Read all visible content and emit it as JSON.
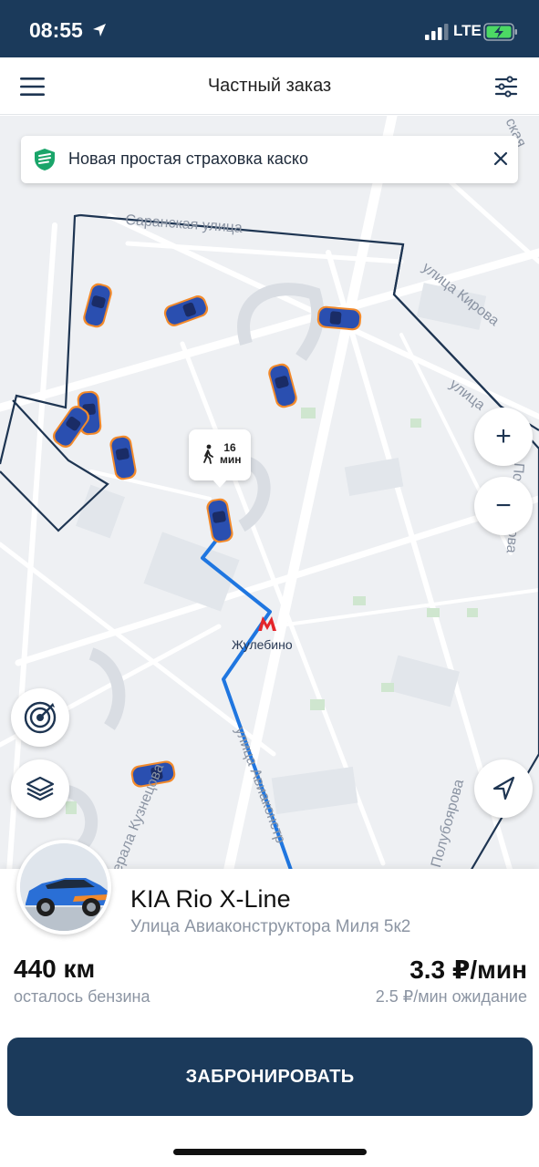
{
  "status_bar": {
    "time": "08:55",
    "network": "LTE",
    "icons": [
      "location-arrow-icon",
      "signal-icon",
      "battery-charging-icon"
    ]
  },
  "header": {
    "title": "Частный заказ",
    "menu_icon": "hamburger-menu-icon",
    "filter_icon": "filter-sliders-icon"
  },
  "promo": {
    "text": "Новая простая страховка каско",
    "icon": "shield-icon",
    "close_icon": "close-icon"
  },
  "map": {
    "walk_time": "16\nмин",
    "walk_icon": "walking-person-icon",
    "metro_station": "Жулебино",
    "streets": {
      "saranskaya": "Саранская улица",
      "kirova": "улица Кирова",
      "ulitsa_right": "улица",
      "generala_kuznetsova": "ерала Кузнецова",
      "aviakonstruktora": "улица Авиаконстр",
      "polubo": "Полубоярова",
      "label_top_right": "ская",
      "label_right_vertical": "ала Полубоярова"
    },
    "controls": {
      "zoom_in": "+",
      "zoom_out": "−",
      "radar_icon": "radar-icon",
      "layers_icon": "layers-icon",
      "locate_icon": "navigation-arrow-icon"
    },
    "colors": {
      "route": "#1f76e0",
      "car_body": "#2a4fb0",
      "car_accent": "#f28a2b",
      "zone_border": "#1e3552"
    }
  },
  "car": {
    "name": "KIA Rio X-Line",
    "address": "Улица Авиаконструктора Миля 5к2",
    "fuel_value": "440 км",
    "fuel_label": "осталось бензина",
    "price_value": "3.3 ₽/мин",
    "price_wait": "2.5 ₽/мин ожидание"
  },
  "actions": {
    "book_label": "ЗАБРОНИРОВАТЬ"
  }
}
